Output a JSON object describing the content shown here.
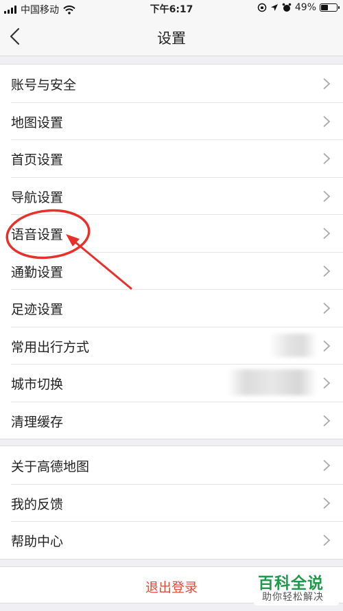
{
  "status_bar": {
    "carrier": "中国移动",
    "time": "下午6:17",
    "battery_text": "49%",
    "battery_level": 0.49
  },
  "nav": {
    "title": "设置",
    "back_icon": "chevron-left-icon"
  },
  "groups": [
    {
      "items": [
        "账号与安全",
        "地图设置",
        "首页设置",
        "导航设置",
        "语音设置",
        "通勤设置",
        "足迹设置",
        "常用出行方式",
        "城市切换",
        "清理缓存"
      ]
    },
    {
      "items": [
        "关于高德地图",
        "我的反馈",
        "帮助中心"
      ]
    }
  ],
  "logout": {
    "label": "退出登录"
  },
  "watermark": {
    "main": "百科全说",
    "sub": "助你轻松解决"
  },
  "colors": {
    "logout": "#e04b3a",
    "annotation": "#e8302a",
    "watermark": "#1f9a4a",
    "background": "#efeff4"
  }
}
